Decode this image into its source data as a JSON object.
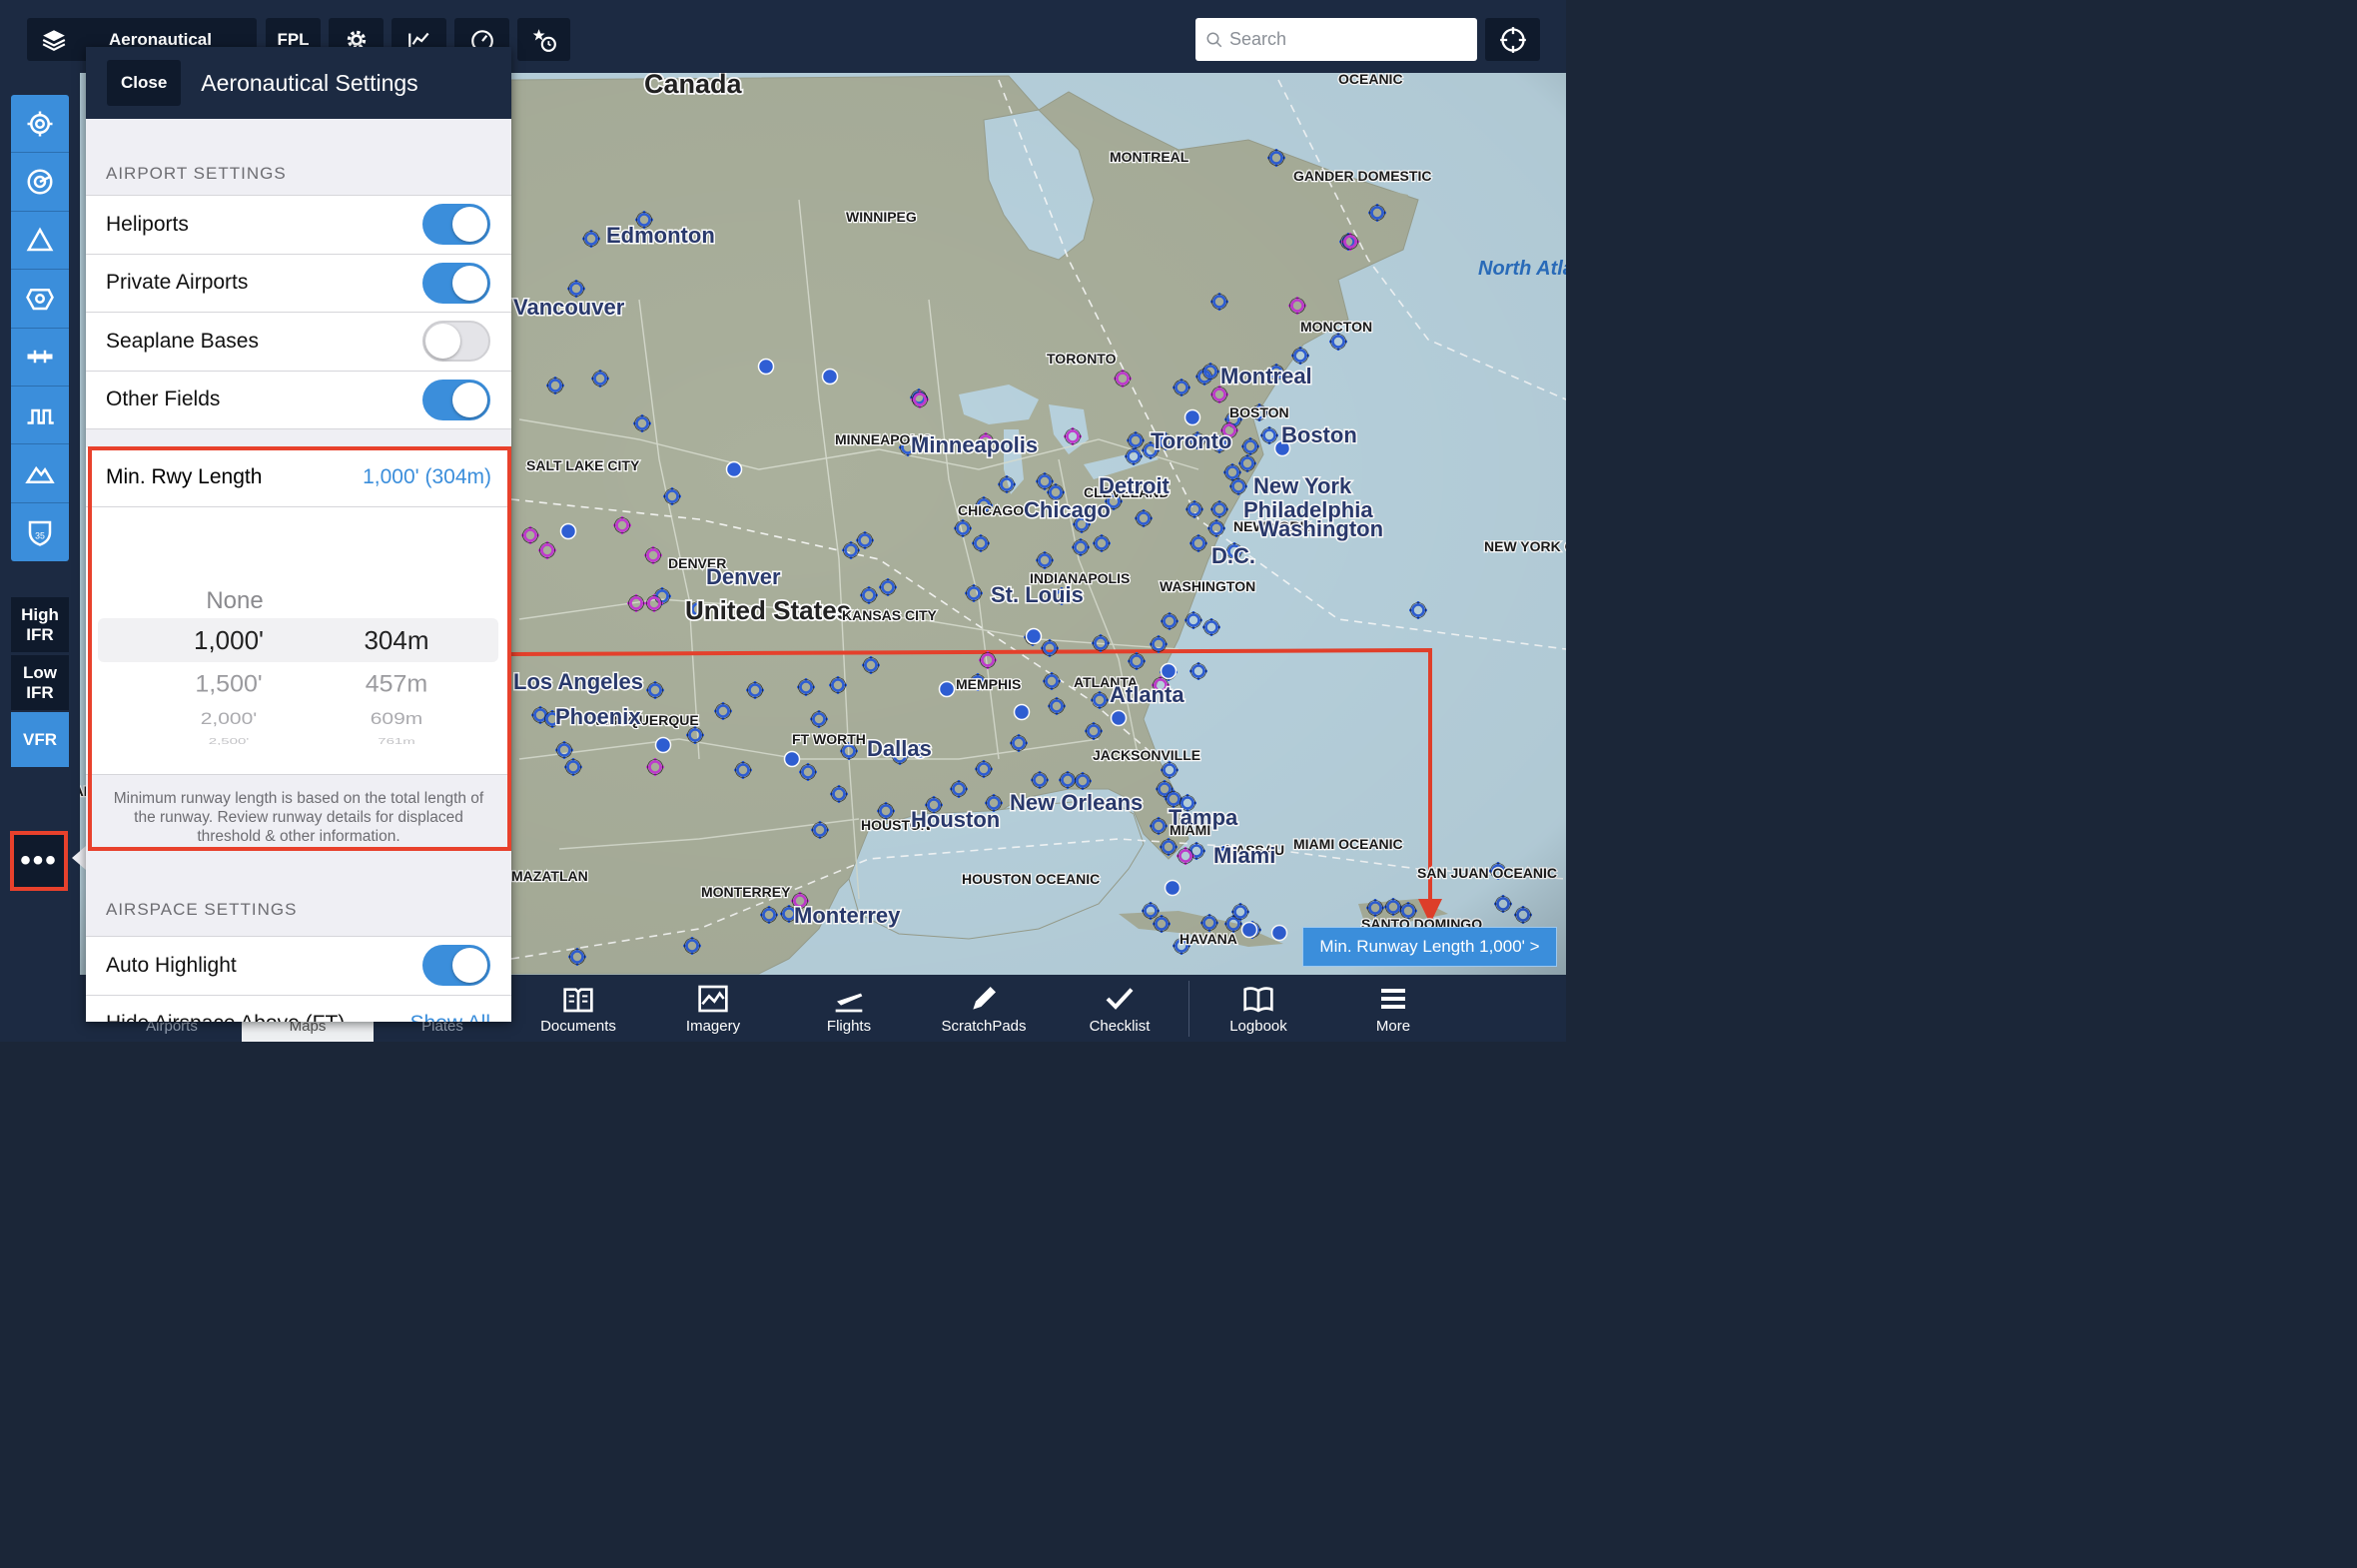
{
  "topbar": {
    "layers_label": "Aeronautical",
    "fpl_label": "FPL",
    "search_placeholder": "Search"
  },
  "left_toolbar": {
    "chart_modes": [
      "High IFR",
      "Low IFR",
      "VFR"
    ],
    "active_chart_mode": "VFR",
    "more_label": "•••"
  },
  "map": {
    "labels": [
      {
        "text": "Canada"
      },
      {
        "text": "MONTREAL"
      },
      {
        "text": "GANDER DOMESTIC"
      },
      {
        "text": "WINNIPEG"
      },
      {
        "text": "Edmonton"
      },
      {
        "text": "North Atlantic"
      },
      {
        "text": "MONCTON"
      },
      {
        "text": "TORONTO"
      },
      {
        "text": "Montreal"
      },
      {
        "text": "BOSTON"
      },
      {
        "text": "Boston"
      },
      {
        "text": "Toronto"
      },
      {
        "text": "MINNEAPOLIS"
      },
      {
        "text": "Minneapolis"
      },
      {
        "text": "SALT LAKE CITY"
      },
      {
        "text": "CLEVELAND"
      },
      {
        "text": "Detroit"
      },
      {
        "text": "New York"
      },
      {
        "text": "Philadelphia"
      },
      {
        "text": "NEW YORK"
      },
      {
        "text": "CHICAGO"
      },
      {
        "text": "Chicago"
      },
      {
        "text": "Washington"
      },
      {
        "text": "D.C."
      },
      {
        "text": "NEW YORK OCEANIC"
      },
      {
        "text": "DENVER"
      },
      {
        "text": "Denver"
      },
      {
        "text": "INDIANAPOLIS"
      },
      {
        "text": "WASHINGTON"
      },
      {
        "text": "United States"
      },
      {
        "text": "KANSAS CITY"
      },
      {
        "text": "St. Louis"
      },
      {
        "text": "Los Angeles"
      },
      {
        "text": "MEMPHIS"
      },
      {
        "text": "ATLANTA"
      },
      {
        "text": "Atlanta"
      },
      {
        "text": "ALBUQUERQUE"
      },
      {
        "text": "Phoenix"
      },
      {
        "text": "FT WORTH"
      },
      {
        "text": "Dallas"
      },
      {
        "text": "JACKSONVILLE"
      },
      {
        "text": "New Orleans"
      },
      {
        "text": "HOUSTON"
      },
      {
        "text": "Houston"
      },
      {
        "text": "Tampa"
      },
      {
        "text": "MIAMI"
      },
      {
        "text": "MIAMI OCEANIC"
      },
      {
        "text": "NASSAU"
      },
      {
        "text": "Miami"
      },
      {
        "text": "MAZATLAN"
      },
      {
        "text": "HOUSTON OCEANIC"
      },
      {
        "text": "SAN JUAN OCEANIC"
      },
      {
        "text": "MONTERREY"
      },
      {
        "text": "Monterrey"
      },
      {
        "text": "HAVANA"
      },
      {
        "text": "SANTO DOMINGO"
      },
      {
        "text": "OCEANIC"
      },
      {
        "text": "OAKLAND OCEANIC"
      },
      {
        "text": "Vancouver"
      }
    ]
  },
  "overlay": {
    "min_runway_tag": "Min. Runway Length 1,000' >"
  },
  "settings_panel": {
    "close_label": "Close",
    "title": "Aeronautical Settings",
    "airport_section_header": "AIRPORT SETTINGS",
    "airport_toggles": [
      {
        "label": "Heliports",
        "on": true
      },
      {
        "label": "Private Airports",
        "on": true
      },
      {
        "label": "Seaplane Bases",
        "on": false
      },
      {
        "label": "Other Fields",
        "on": true
      }
    ],
    "min_rwy": {
      "label": "Min. Rwy Length",
      "value": "1,000' (304m)",
      "picker_none": "None",
      "picker_rows": [
        {
          "ft": "1,000'",
          "m": "304m",
          "selected": true
        },
        {
          "ft": "1,500'",
          "m": "457m"
        },
        {
          "ft": "2,000'",
          "m": "609m"
        },
        {
          "ft": "2,500'",
          "m": "761m"
        }
      ],
      "note": "Minimum runway length is based on the total length of the runway. Review runway details for displaced threshold & other information."
    },
    "airspace_section_header": "AIRSPACE SETTINGS",
    "auto_highlight": {
      "label": "Auto Highlight",
      "on": true
    },
    "hide_airspace": {
      "label": "Hide Airspace Above (FT)",
      "value": "Show All"
    }
  },
  "bottom_tabs": [
    {
      "label": "Airports",
      "icon": "airports-icon"
    },
    {
      "label": "Maps",
      "icon": "maps-icon"
    },
    {
      "label": "Plates",
      "icon": "plates-icon"
    },
    {
      "label": "Documents",
      "icon": "documents-icon"
    },
    {
      "label": "Imagery",
      "icon": "imagery-icon"
    },
    {
      "label": "Flights",
      "icon": "flights-icon"
    },
    {
      "label": "ScratchPads",
      "icon": "scratchpads-icon"
    },
    {
      "label": "Checklist",
      "icon": "checklist-icon"
    },
    {
      "label": "Logbook",
      "icon": "logbook-icon"
    },
    {
      "label": "More",
      "icon": "more-icon"
    }
  ],
  "colors": {
    "accent": "#3b8edb",
    "highlight_red": "#e8412c",
    "bar_navy": "#1c2a42",
    "map_land": "#aab09c",
    "map_water": "#b9d3df",
    "airport_blue": "#2f5fd6",
    "airport_magenta": "#c23bd0"
  }
}
